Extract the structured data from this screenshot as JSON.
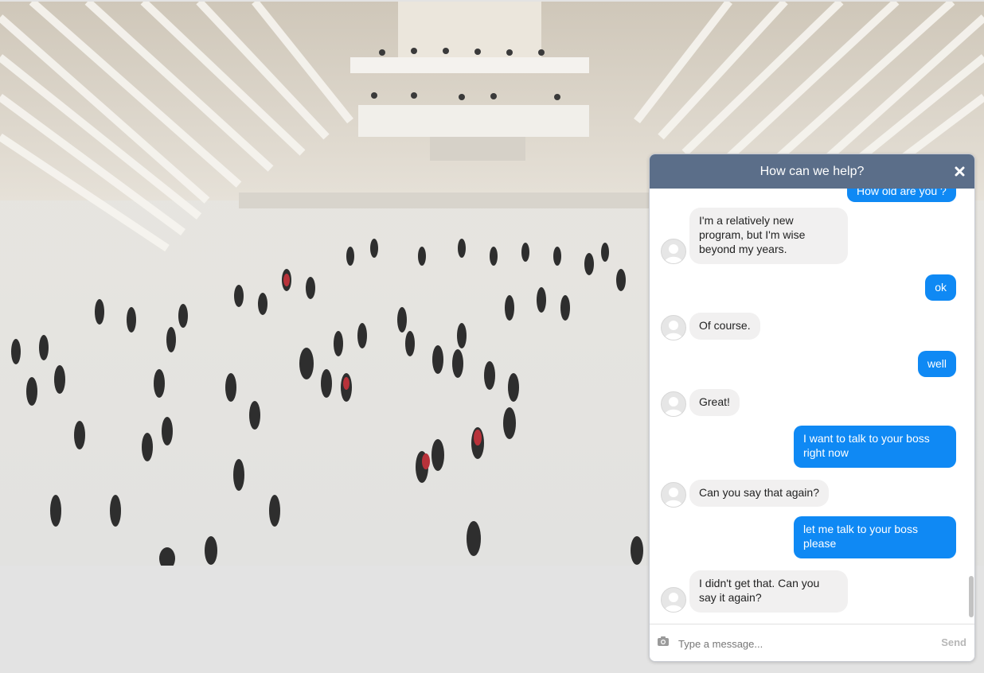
{
  "chat": {
    "title": "How can we help?",
    "messages": [
      {
        "sender": "user",
        "text": "How old are you ?"
      },
      {
        "sender": "bot",
        "text": "I'm a relatively new program, but I'm wise beyond my years."
      },
      {
        "sender": "user",
        "text": "ok"
      },
      {
        "sender": "bot",
        "text": "Of course."
      },
      {
        "sender": "user",
        "text": "well"
      },
      {
        "sender": "bot",
        "text": "Great!"
      },
      {
        "sender": "user",
        "text": "I want to talk to your boss right now"
      },
      {
        "sender": "bot",
        "text": "Can you say that again?"
      },
      {
        "sender": "user",
        "text": "let me talk to your boss please"
      },
      {
        "sender": "bot",
        "text": "I didn't get that. Can you say it again?"
      }
    ],
    "input": {
      "placeholder": "Type a message...",
      "value": ""
    },
    "send_label": "Send",
    "icons": {
      "close": "close-icon",
      "camera": "camera-icon",
      "avatar": "user-avatar-icon"
    }
  },
  "colors": {
    "header": "#5b6e89",
    "user_bubble": "#0f89f4",
    "bot_bubble": "#f1f0f0"
  }
}
